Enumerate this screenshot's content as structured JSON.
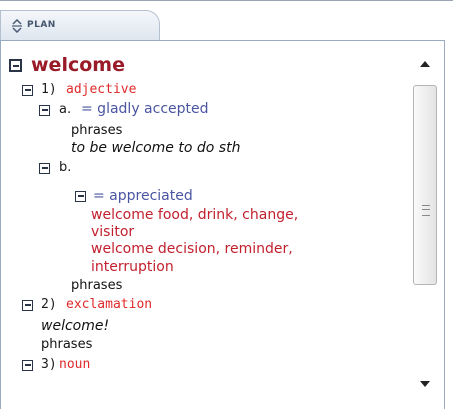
{
  "tab": {
    "label": "PLAN",
    "icon": "expand-collapse-icon"
  },
  "entry": {
    "headword": "welcome",
    "senses": [
      {
        "number": "1)",
        "pos": "adjective"
      },
      {
        "number": "2)",
        "pos": "exclamation"
      },
      {
        "number": "3)",
        "pos": "noun"
      }
    ],
    "sub_a": {
      "letter": "a.",
      "definition": "= gladly accepted",
      "phrases_label": "phrases",
      "example": "to be welcome to do sth"
    },
    "sub_b": {
      "letter": "b.",
      "definition": "= appreciated",
      "collocations": [
        "welcome food, drink, change,",
        "visitor",
        "welcome decision, reminder,",
        "interruption"
      ],
      "phrases_label": "phrases"
    },
    "exclamation": {
      "example": "welcome!",
      "phrases_label": "phrases"
    }
  },
  "colors": {
    "headword": "#9a1b28",
    "pos": "#e02a2a",
    "definition": "#4a55a2",
    "collocation": "#c2202e"
  }
}
